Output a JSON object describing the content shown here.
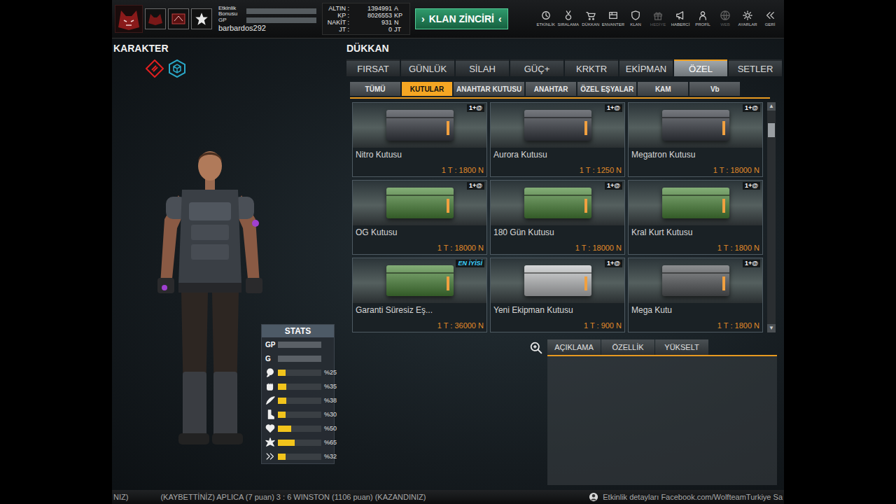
{
  "top_bar": {
    "meters": [
      {
        "label": "Etkinlik Bonusu",
        "level": 0
      },
      {
        "label": "GP",
        "level": 0
      }
    ],
    "username": "barbardos292",
    "currencies": [
      {
        "label": "ALTIN :",
        "value": "1394991",
        "unit": "A"
      },
      {
        "label": "KP :",
        "value": "8026553",
        "unit": "KP"
      },
      {
        "label": "NAKİT :",
        "value": "931",
        "unit": "N"
      },
      {
        "label": "JT :",
        "value": "0",
        "unit": "JT"
      }
    ],
    "clan_button": {
      "label": "KLAN ZİNCİRİ",
      "left_arrow": "›",
      "right_arrow": "‹"
    },
    "nav": [
      {
        "label": "ETKİNLİK",
        "disabled": false
      },
      {
        "label": "SIRALAMA",
        "disabled": false
      },
      {
        "label": "DÜKKAN",
        "disabled": false
      },
      {
        "label": "ENVANTER",
        "disabled": false
      },
      {
        "label": "KLAN",
        "disabled": false
      },
      {
        "label": "HEDİYE",
        "disabled": true
      },
      {
        "label": "HABERCİ",
        "disabled": false
      },
      {
        "label": "PROFİL",
        "disabled": false
      },
      {
        "label": "WEB",
        "disabled": true
      },
      {
        "label": "AYARLAR",
        "disabled": false
      },
      {
        "label": "GERİ",
        "disabled": false
      }
    ]
  },
  "character": {
    "title": "KARAKTER"
  },
  "stats": {
    "title": "STATS",
    "rows": [
      {
        "label": "GP",
        "kind": "bar",
        "level": 0
      },
      {
        "label": "G",
        "kind": "bar",
        "level": 0
      },
      {
        "kind": "percent",
        "level": 0.17,
        "reading": "%25"
      },
      {
        "kind": "percent",
        "level": 0.2,
        "reading": "%35"
      },
      {
        "kind": "percent",
        "level": 0.2,
        "reading": "%38"
      },
      {
        "kind": "percent",
        "level": 0.18,
        "reading": "%30"
      },
      {
        "kind": "percent",
        "level": 0.3,
        "reading": "%50"
      },
      {
        "kind": "percent",
        "level": 0.38,
        "reading": "%65"
      },
      {
        "kind": "percent",
        "level": 0.18,
        "reading": "%32"
      }
    ]
  },
  "shop": {
    "title": "DÜKKAN",
    "tabs": [
      {
        "label": "FIRSAT",
        "selected": false
      },
      {
        "label": "GÜNLÜK",
        "selected": false
      },
      {
        "label": "SİLAH",
        "selected": false
      },
      {
        "label": "GÜÇ+",
        "selected": false
      },
      {
        "label": "KRKTR",
        "selected": false
      },
      {
        "label": "EKİPMAN",
        "selected": false
      },
      {
        "label": "ÖZEL",
        "selected": true
      },
      {
        "label": "SETLER",
        "selected": false
      }
    ],
    "subtabs": [
      {
        "label": "TÜMÜ",
        "selected": false
      },
      {
        "label": "KUTULAR",
        "selected": true
      },
      {
        "label": "ANAHTAR KUTUSU",
        "selected": false
      },
      {
        "label": "ANAHTAR",
        "selected": false
      },
      {
        "label": "ÖZEL EŞYALAR",
        "selected": false
      },
      {
        "label": "KAM",
        "selected": false
      },
      {
        "label": "Vb",
        "selected": false
      }
    ],
    "items": [
      {
        "name": "Nitro Kutusu",
        "price": "1 T : 1800 N",
        "badge": "1+@",
        "badge_kind": "count",
        "color": "#3b3f47"
      },
      {
        "name": "Aurora Kutusu",
        "price": "1 T : 1250 N",
        "badge": "1+@",
        "badge_kind": "count",
        "color": "#3b3f47"
      },
      {
        "name": "Megatron Kutusu",
        "price": "1 T : 18000 N",
        "badge": "1+@",
        "badge_kind": "count",
        "color": "#3b3f47"
      },
      {
        "name": "OG Kutusu",
        "price": "1 T : 18000 N",
        "badge": "1+@",
        "badge_kind": "count",
        "color": "#4e8a3c"
      },
      {
        "name": "180 Gün Kutusu",
        "price": "1 T : 18000 N",
        "badge": "1+@",
        "badge_kind": "count",
        "color": "#4e8a3c"
      },
      {
        "name": "Kral Kurt Kutusu",
        "price": "1 T : 1800 N",
        "badge": "1+@",
        "badge_kind": "count",
        "color": "#4e8a3c"
      },
      {
        "name": "Garanti Süresiz Eş...",
        "price": "1 T : 36000 N",
        "badge": "EN İYİSİ",
        "badge_kind": "best",
        "color": "#4e8a3c"
      },
      {
        "name": "Yeni Ekipman Kutusu",
        "price": "1 T : 900 N",
        "badge": "1+@",
        "badge_kind": "count",
        "color": "#c4c6c8"
      },
      {
        "name": "Mega Kutu",
        "price": "1 T : 1800 N",
        "badge": "1+@",
        "badge_kind": "count",
        "color": "#5a5d60"
      }
    ],
    "scrollbar": {
      "up": "▲",
      "down": "▼",
      "level": 0.06
    },
    "detail_tabs": [
      {
        "label": "AÇIKLAMA",
        "selected": false
      },
      {
        "label": "ÖZELLİK",
        "selected": false
      },
      {
        "label": "YÜKSELT",
        "selected": false
      }
    ]
  },
  "ticker": {
    "left_fragment": "NIZ)",
    "match": "(KAYBETTİNİZ) APLICA (7 puan) 3 : 6 WINSTON (1106 puan) (KAZANDINIZ)",
    "event": "Etkinlik detayları Facebook.com/WolfteamTurkiye Sa"
  }
}
